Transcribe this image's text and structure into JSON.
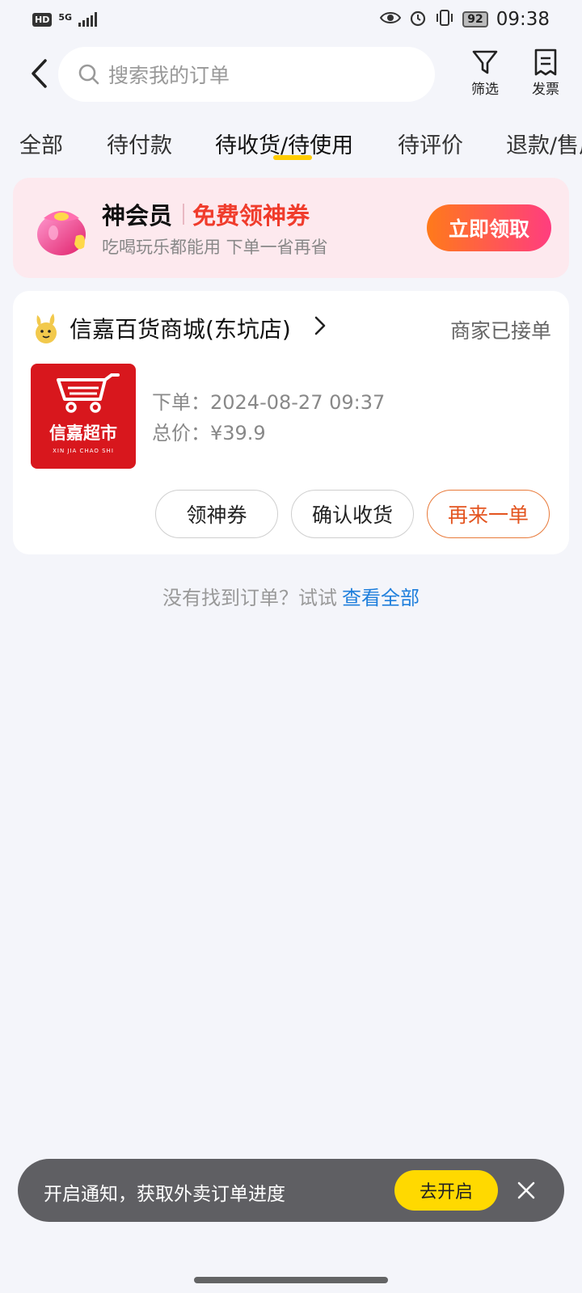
{
  "status_bar": {
    "hd_badge": "HD",
    "network": "5G",
    "battery": "92",
    "time": "09:38"
  },
  "header": {
    "search_placeholder": "搜索我的订单",
    "filter_label": "筛选",
    "invoice_label": "发票"
  },
  "tabs": [
    {
      "label": "全部"
    },
    {
      "label": "待付款"
    },
    {
      "label": "待收货/待使用",
      "active": true
    },
    {
      "label": "待评价"
    },
    {
      "label": "退款/售后"
    }
  ],
  "member_banner": {
    "title": "神会员",
    "promo": "免费领神券",
    "subtitle": "吃喝玩乐都能用 下单一省再省",
    "button": "立即领取"
  },
  "order": {
    "store_name": "信嘉百货商城(东坑店)",
    "status": "商家已接单",
    "logo_text_cn": "信嘉超市",
    "logo_text_en": "XIN JIA CHAO SHI",
    "order_time": "下单：2024-08-27 09:37",
    "total": "总价：¥39.9",
    "buttons": {
      "coupon": "领神券",
      "confirm": "确认收货",
      "reorder": "再来一单"
    }
  },
  "empty_hint": {
    "text": "没有找到订单？试试",
    "link": "查看全部"
  },
  "notification": {
    "text": "开启通知，获取外卖订单进度",
    "button": "去开启"
  },
  "colors": {
    "accent_yellow": "#ffcc00",
    "promo_red": "#f03c2c",
    "link_blue": "#1f7fdc",
    "reorder_orange": "#e3541f",
    "logo_red": "#d8171d"
  }
}
